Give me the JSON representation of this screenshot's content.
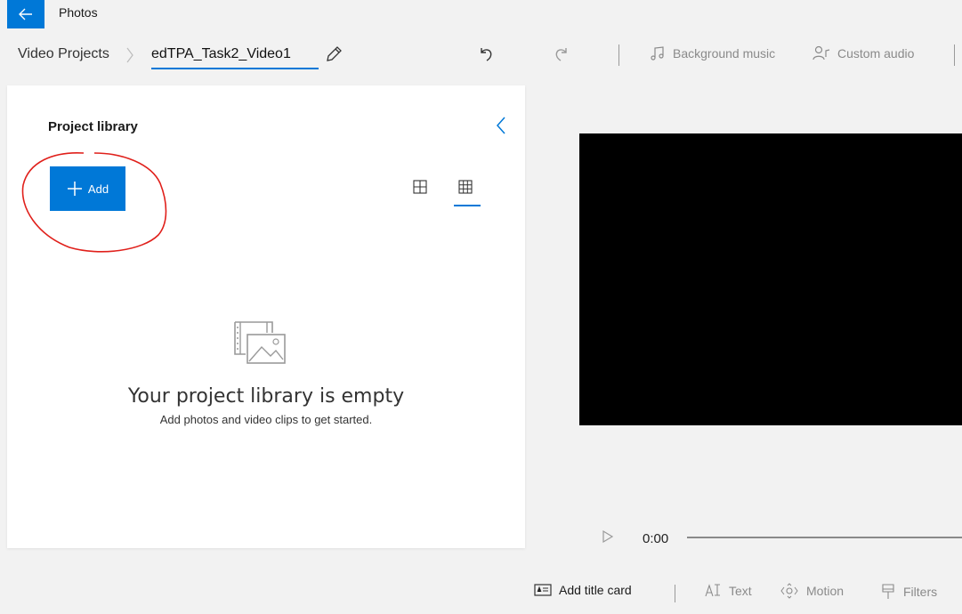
{
  "app": {
    "title": "Photos"
  },
  "breadcrumb": {
    "root": "Video Projects",
    "current": "edTPA_Task2_Video1"
  },
  "toolbar": {
    "background_music": "Background music",
    "custom_audio": "Custom audio"
  },
  "library": {
    "title": "Project library",
    "add_label": "Add",
    "empty_title": "Your project library is empty",
    "empty_subtitle": "Add photos and video clips to get started."
  },
  "player": {
    "time": "0:00"
  },
  "bottom": {
    "add_title_card": "Add title card",
    "text": "Text",
    "motion": "Motion",
    "filters": "Filters"
  },
  "colors": {
    "accent": "#0078d7",
    "annotation": "#e0201b"
  },
  "icons": [
    "back-arrow-icon",
    "pencil-icon",
    "undo-icon",
    "redo-icon",
    "music-note-icon",
    "custom-audio-icon",
    "chevron-left-icon",
    "plus-icon",
    "large-grid-icon",
    "small-grid-icon",
    "media-placeholder-icon",
    "play-icon",
    "title-card-icon",
    "text-icon",
    "motion-icon",
    "filters-icon"
  ]
}
